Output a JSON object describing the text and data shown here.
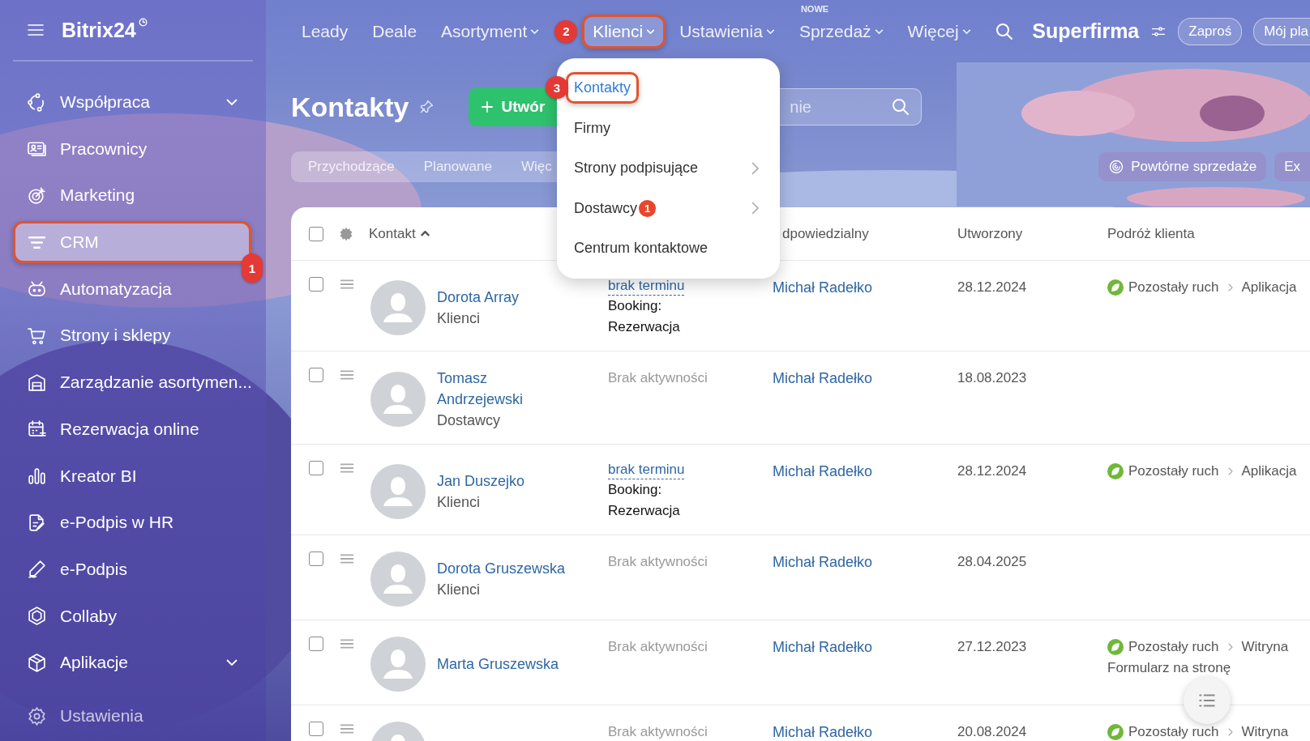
{
  "sidebar": {
    "logo": "Bitrix24",
    "items": [
      {
        "label": "Współpraca",
        "expandable": true,
        "selected": false
      },
      {
        "label": "Pracownicy",
        "expandable": false,
        "selected": false
      },
      {
        "label": "Marketing",
        "expandable": false,
        "selected": false
      },
      {
        "label": "CRM",
        "expandable": false,
        "selected": true,
        "step": "1"
      },
      {
        "label": "Automatyzacja",
        "expandable": false,
        "selected": false
      },
      {
        "label": "Strony i sklepy",
        "expandable": false,
        "selected": false
      },
      {
        "label": "Zarządzanie asortymen...",
        "expandable": false,
        "selected": false
      },
      {
        "label": "Rezerwacja online",
        "expandable": false,
        "selected": false
      },
      {
        "label": "Kreator BI",
        "expandable": false,
        "selected": false
      },
      {
        "label": "e-Podpis w HR",
        "expandable": false,
        "selected": false
      },
      {
        "label": "e-Podpis",
        "expandable": false,
        "selected": false
      },
      {
        "label": "Collaby",
        "expandable": false,
        "selected": false
      },
      {
        "label": "Aplikacje",
        "expandable": true,
        "selected": false
      },
      {
        "label": "Ustawienia",
        "expandable": false,
        "selected": false
      }
    ]
  },
  "topbar": {
    "nav": [
      {
        "label": "Leady",
        "dropdown": false,
        "selected": false
      },
      {
        "label": "Deale",
        "dropdown": false,
        "selected": false
      },
      {
        "label": "Asortyment",
        "dropdown": true,
        "selected": false
      },
      {
        "label": "Klienci",
        "dropdown": true,
        "selected": true,
        "step": "2"
      },
      {
        "label": "Ustawienia",
        "dropdown": true,
        "selected": false
      },
      {
        "label": "Sprzedaż",
        "dropdown": true,
        "selected": false,
        "tag": "NOWE"
      },
      {
        "label": "Więcej",
        "dropdown": true,
        "selected": false
      }
    ],
    "company": "Superfirma",
    "buttons": [
      "Zaproś",
      "Mój pla"
    ]
  },
  "menu": {
    "items": [
      {
        "label": "Kontakty",
        "selected": true,
        "submenu": false,
        "step": "3"
      },
      {
        "label": "Firmy",
        "selected": false,
        "submenu": false
      },
      {
        "label": "Strony podpisujące",
        "selected": false,
        "submenu": true
      },
      {
        "label": "Dostawcy",
        "selected": false,
        "submenu": true,
        "count": "1"
      },
      {
        "label": "Centrum kontaktowe",
        "selected": false,
        "submenu": false
      }
    ]
  },
  "page": {
    "title": "Kontakty",
    "create_button": "Utwór",
    "search": {
      "placeholder": "nie"
    },
    "filters": [
      "Przychodzące",
      "Planowane",
      "Więc"
    ],
    "right_buttons": [
      "Powtórne sprzedaże",
      "Ex"
    ]
  },
  "table": {
    "all_checked": false,
    "columns": [
      {
        "label": "Kontakt",
        "sorted_ascending": true
      },
      {
        "label": "dpowiedzialny"
      },
      {
        "label": "Utworzony"
      },
      {
        "label": "Podróż klienta"
      }
    ],
    "rows": [
      {
        "checked": false,
        "name": "Dorota Array",
        "type": "Klienci",
        "activity": {
          "kind": "deadline",
          "text": "brak terminu",
          "note": "Booking: Rezerwacja"
        },
        "responsible": "Michał Radełko",
        "created": "28.12.2024",
        "journey": {
          "source": "Pozostały ruch",
          "target": "Aplikacja"
        }
      },
      {
        "checked": false,
        "name": "Tomasz Andrzejewski",
        "type": "Dostawcy",
        "activity": {
          "kind": "none",
          "text": "Brak aktywności"
        },
        "responsible": "Michał Radełko",
        "created": "18.08.2023"
      },
      {
        "checked": false,
        "name": "Jan Duszejko",
        "type": "Klienci",
        "activity": {
          "kind": "deadline",
          "text": "brak terminu",
          "note": "Booking: Rezerwacja"
        },
        "responsible": "Michał Radełko",
        "created": "28.12.2024",
        "journey": {
          "source": "Pozostały ruch",
          "target": "Aplikacja"
        }
      },
      {
        "checked": false,
        "name": "Dorota Gruszewska",
        "type": "Klienci",
        "activity": {
          "kind": "none",
          "text": "Brak aktywności"
        },
        "responsible": "Michał Radełko",
        "created": "28.04.2025"
      },
      {
        "checked": false,
        "name": "Marta Gruszewska",
        "activity": {
          "kind": "none",
          "text": "Brak aktywności"
        },
        "responsible": "Michał Radełko",
        "created": "27.12.2023",
        "journey": {
          "source": "Pozostały ruch",
          "target": "Witryna",
          "detail": "Formularz na stronę"
        }
      },
      {
        "checked": false,
        "activity": {
          "kind": "none",
          "text": "Brak aktywności"
        },
        "responsible": "Michał Radełko",
        "created": "20.08.2024",
        "journey": {
          "source": "Pozostały ruch",
          "target": "Witryna"
        }
      }
    ]
  }
}
